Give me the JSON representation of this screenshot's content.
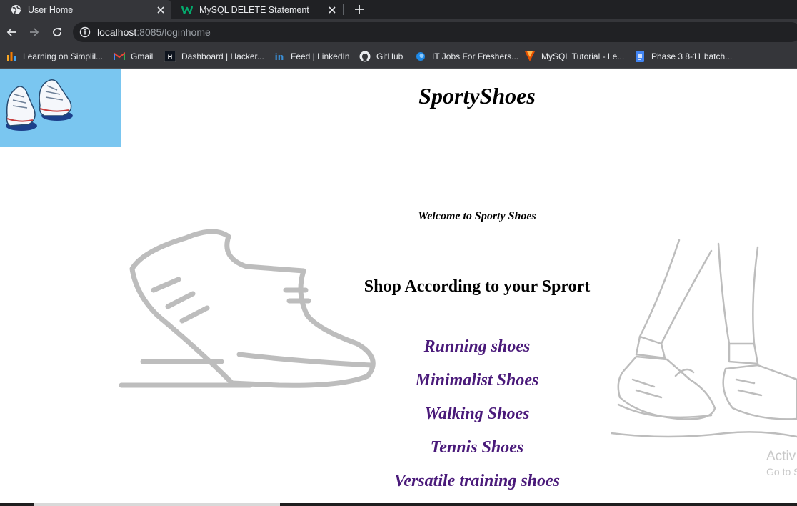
{
  "browser": {
    "tabs": [
      {
        "title": "User Home",
        "icon": "globe-icon",
        "active": true
      },
      {
        "title": "MySQL DELETE Statement",
        "icon": "w3schools-icon",
        "active": false
      }
    ],
    "address": {
      "host": "localhost",
      "rest": ":8085/loginhome"
    },
    "bookmarks": [
      {
        "label": "Learning on Simplil...",
        "icon": "simplilearn-icon"
      },
      {
        "label": "Gmail",
        "icon": "gmail-icon"
      },
      {
        "label": "Dashboard | Hacker...",
        "icon": "hackerrank-icon"
      },
      {
        "label": "Feed | LinkedIn",
        "icon": "linkedin-icon"
      },
      {
        "label": "GitHub",
        "icon": "github-icon"
      },
      {
        "label": "IT Jobs For Freshers...",
        "icon": "jobs-icon"
      },
      {
        "label": "MySQL Tutorial - Le...",
        "icon": "mysql-tutorial-icon"
      },
      {
        "label": "Phase 3 8-11 batch...",
        "icon": "docs-icon"
      }
    ]
  },
  "page": {
    "brand": "SportyShoes",
    "welcome": "Welcome to Sporty Shoes",
    "heading": "Shop According to your Sprort",
    "sports": [
      "Running shoes",
      "Minimalist Shoes",
      "Walking Shoes",
      "Tennis Shoes",
      "Versatile training shoes"
    ],
    "watermark": {
      "line1": "Activ",
      "line2": "Go to S"
    }
  },
  "colors": {
    "chrome_dark": "#202124",
    "chrome_tab": "#35363a",
    "logo_bg": "#7ac6f0",
    "link": "#4a1a7a",
    "sketch": "#bdbdbd"
  }
}
